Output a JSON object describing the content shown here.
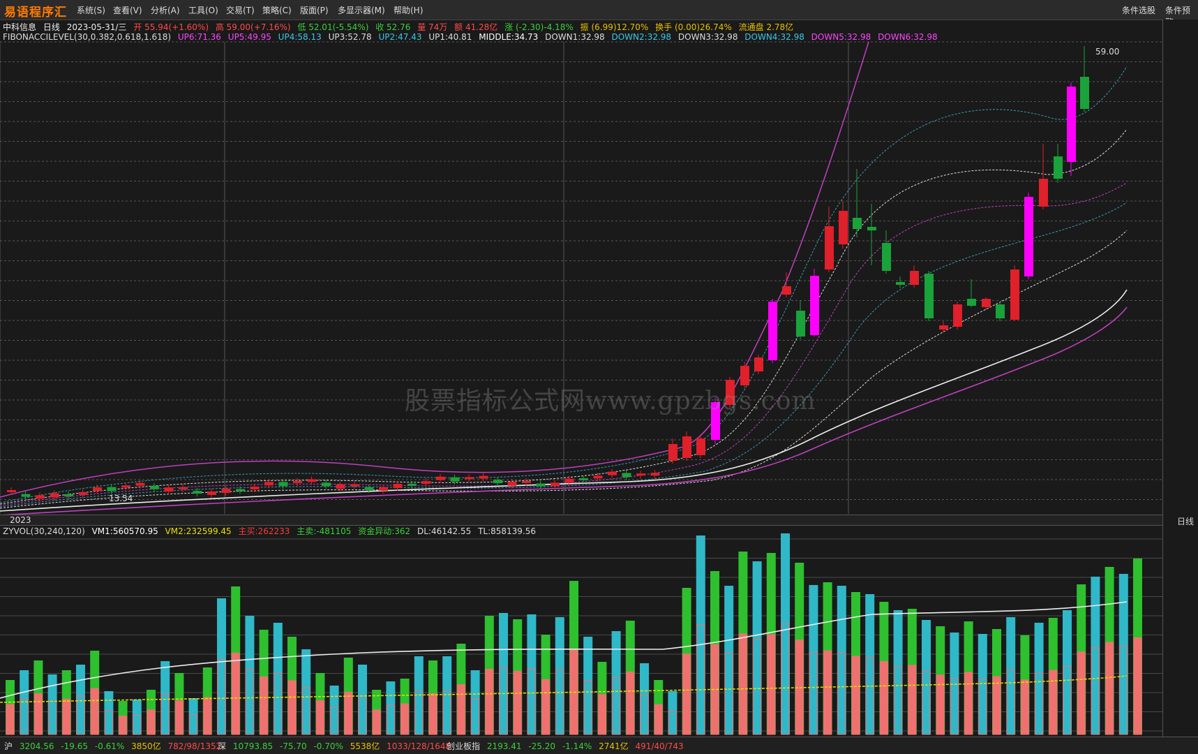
{
  "app": {
    "logo": "易语程序汇",
    "menus": [
      "系统(S)",
      "查看(V)",
      "分析(A)",
      "工具(O)",
      "交易(T)",
      "策略(C)",
      "版面(P)",
      "多显示器(M)",
      "帮助(H)"
    ],
    "right_buttons": [
      "条件选股",
      "条件预警"
    ]
  },
  "quote": {
    "name": "中科信息",
    "period": "日线",
    "date": "2023-05-31/三",
    "open": "开 55.94(+1.60%)",
    "high": "高 59.00(+7.16%)",
    "low": "低 52.01(-5.54%)",
    "close": "收 52.76",
    "volume": "量 74万",
    "amount": "额 41.28亿",
    "change": "涨 (-2.30)-4.18%",
    "amplitude": "振 (6.99)12.70%",
    "turnover": "换手 (0.00)26.74%",
    "float": "流通盘 2.78亿"
  },
  "indicator": {
    "name": "FIBONACCILEVEL(30,0.382,0.618,1.618)",
    "up6": "UP6:71.36",
    "up5": "UP5:49.95",
    "up4": "UP4:58.13",
    "up3": "UP3:52.78",
    "up2": "UP2:47.43",
    "up1": "UP1:40.81",
    "middle": "MIDDLE:34.73",
    "down1": "DOWN1:32.98",
    "down2": "DOWN2:32.98",
    "down3": "DOWN3:32.98",
    "down4": "DOWN4:32.98",
    "down5": "DOWN5:32.98",
    "down6": "DOWN6:32.98"
  },
  "chart_labels": {
    "high_marker": "59.00",
    "low_marker": "13.54",
    "year": "2023",
    "watermark": "股票指标公式网www.gpzbgs.com",
    "period_tab": "日线"
  },
  "volume_indicator": {
    "name": "ZYVOL(30,240,120)",
    "vm1": "VM1:560570.95",
    "vm2": "VM2:232599.45",
    "main_buy": "主买:262233",
    "main_sell": "主卖:-481105",
    "fund": "资金异动:362",
    "dl": "DL:46142.55",
    "tl": "TL:858139.56"
  },
  "status": {
    "sh": [
      "沪",
      "3204.56",
      "-19.65",
      "-0.61%",
      "3850亿",
      "782/98/1352"
    ],
    "sz": [
      "深",
      "10793.85",
      "-75.70",
      "-0.70%",
      "5538亿",
      "1033/128/1648"
    ],
    "cy": [
      "创业板指",
      "2193.41",
      "-25.20",
      "-1.14%",
      "2741亿",
      "491/40/743"
    ]
  },
  "colors": {
    "up": "#e0202a",
    "down": "#1aa33a",
    "limit": "#ff00ff",
    "vol_red": "#f07070",
    "vol_green": "#2ec02e",
    "vol_cyan": "#2fb8c8"
  }
}
